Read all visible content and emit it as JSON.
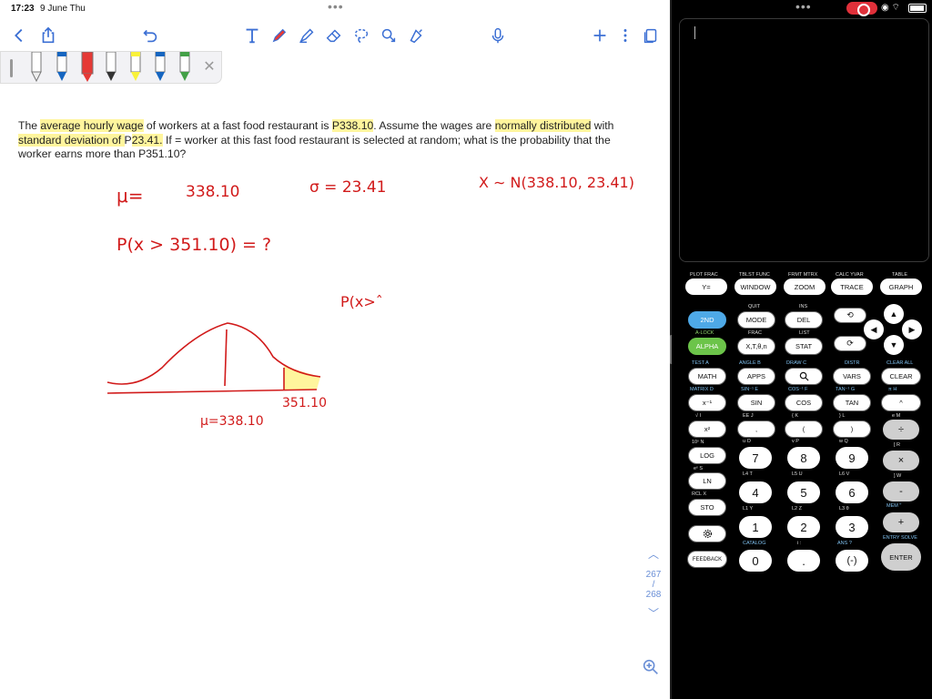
{
  "status": {
    "time": "17:23",
    "date": "9 June Thu"
  },
  "toolbar": {
    "icons": [
      "back-icon",
      "share-icon",
      "undo-icon",
      "text-icon",
      "pen-icon",
      "highlighter-icon",
      "eraser-icon",
      "lasso-icon",
      "shapes-icon",
      "fill-icon",
      "mic-icon",
      "plus-icon",
      "more-icon",
      "pages-icon"
    ]
  },
  "pen_colors": [
    "#ffffff",
    "#1565c0",
    "#e53935",
    "#ffffff",
    "#f9f13a",
    "#1565c0",
    "#43a047"
  ],
  "problem": {
    "t1": "The ",
    "h1": "average hourly wage",
    "t2": " of workers at a fast food restaurant is ",
    "h2": "P338.10",
    "t3": ". Assume the wages are ",
    "h3": "normally distributed",
    "t4": " with ",
    "h4": "standard deviation of ",
    "t5": "P",
    "h5": "23.41.",
    "t6": " If = worker at this fast food restaurant is selected at random; what is the probability that the worker earns more than P351.10?"
  },
  "ink": {
    "mu": "μ=",
    "mu_val": "338.10",
    "sigma": "σ = 23.41",
    "dist": "X ∼ N(338.10, 23.41)",
    "prob": "P(x > 351.10) = ?",
    "partial": "P(x>ˆ",
    "mu_axis": "μ=338.10",
    "x_axis": "351.10",
    "ink_color": "#d11a1a",
    "shade_color": "#fff59d"
  },
  "page_nav": {
    "current": "267",
    "sep": "/",
    "total": "268"
  },
  "calc": {
    "top_keys": [
      {
        "label": "Y=",
        "top": "PLOT  FRAC"
      },
      {
        "label": "WINDOW",
        "top": "TBLST  FUNC"
      },
      {
        "label": "ZOOM",
        "top": "FRMT  MTRX"
      },
      {
        "label": "TRACE",
        "top": "CALC  YVAR"
      },
      {
        "label": "GRAPH",
        "top": "TABLE"
      }
    ],
    "row1": {
      "k1": "2ND",
      "k2": "MODE",
      "k3": "DEL",
      "l2": "QUIT",
      "l3": "INS"
    },
    "row2": {
      "k1": "ALPHA",
      "k2": "X,T,θ,n",
      "k3": "STAT",
      "l1": "A-LOCK",
      "l2": "FRAC",
      "l3": "LIST"
    },
    "row3": {
      "k1": "MATH",
      "k2": "APPS",
      "k4": "VARS",
      "k5": "CLEAR",
      "l1": "TEST  A",
      "l2": "ANGLE  B",
      "l3": "DRAW  C",
      "l4": "DISTR",
      "l5": "CLEAR ALL"
    },
    "row4": {
      "k1": "x⁻¹",
      "k2": "SIN",
      "k3": "COS",
      "k4": "TAN",
      "k5": "^",
      "l1": "MATRIX  D",
      "l2": "SIN⁻¹  E",
      "l3": "COS⁻¹  F",
      "l4": "TAN⁻¹  G",
      "l5": "π  H"
    },
    "row5": {
      "k1": "x²",
      "k2": ",",
      "k3": "(",
      "k4": ")",
      "k5": "÷",
      "l1": "√  I",
      "l2": "EE  J",
      "l3": "{  K",
      "l4": "}  L",
      "l5": "e  M"
    },
    "row6": {
      "k1": "LOG",
      "k2": "7",
      "k3": "8",
      "k4": "9",
      "k5": "×",
      "l1": "10ˣ  N",
      "l2": "u  O",
      "l3": "v  P",
      "l4": "w  Q",
      "l5": "[  R"
    },
    "row7": {
      "k1": "LN",
      "k2": "4",
      "k3": "5",
      "k4": "6",
      "k5": "-",
      "l1": "eˣ  S",
      "l2": "L4  T",
      "l3": "L5  U",
      "l4": "L6  V",
      "l5": "]  W"
    },
    "row8": {
      "k1": "STO",
      "k2": "1",
      "k3": "2",
      "k4": "3",
      "k5": "+",
      "l1": "RCL  X",
      "l2": "L1  Y",
      "l3": "L2  Z",
      "l4": "L3  θ",
      "l5": "MEM  \""
    },
    "row9": {
      "k2": "0",
      "k3": ".",
      "k4": "(-)",
      "k5": "ENTER",
      "l2": "CATALOG",
      "l3": "i  :",
      "l4": "ANS  ?",
      "l5": "ENTRY SOLVE"
    },
    "feedback": "FEEDBACK",
    "colors": {
      "second": "#4ea9e7",
      "alpha": "#6cc44a"
    }
  }
}
